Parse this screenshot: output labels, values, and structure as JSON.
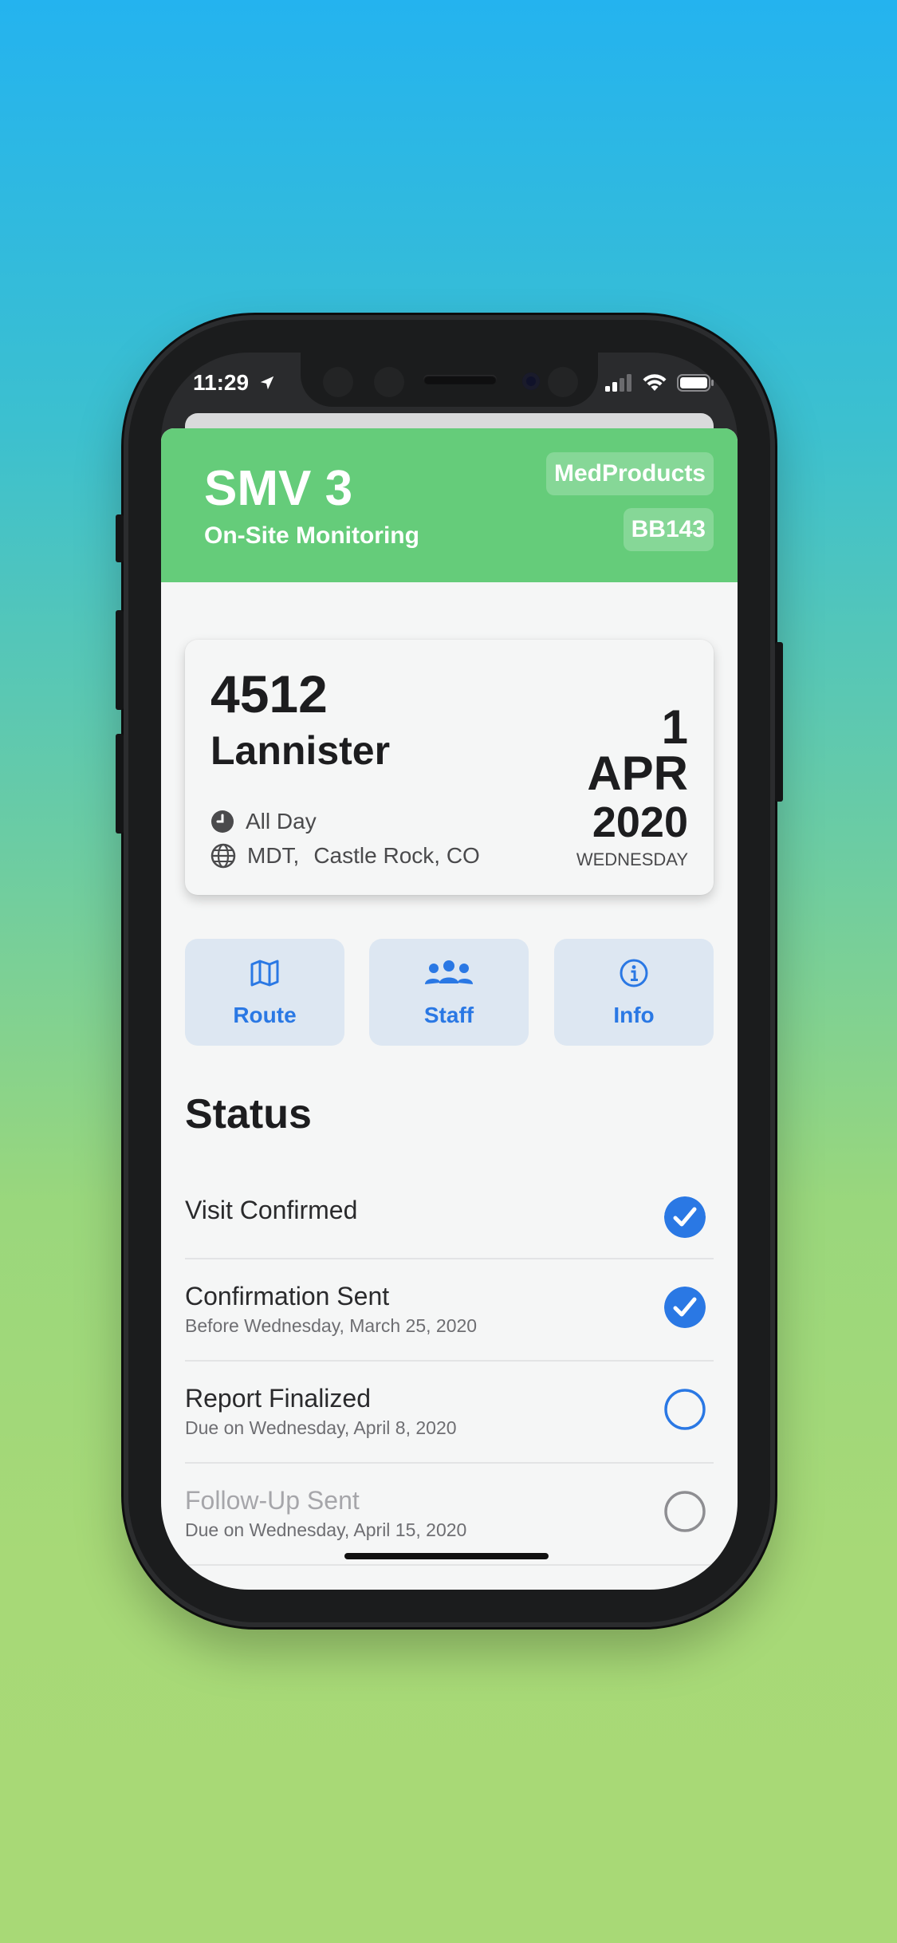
{
  "status_bar": {
    "time": "11:29"
  },
  "header": {
    "title": "SMV 3",
    "subtitle": "On-Site Monitoring",
    "tag_company": "MedProducts",
    "tag_code": "BB143"
  },
  "visit_card": {
    "number": "4512",
    "name": "Lannister",
    "duration": "All Day",
    "timezone": "MDT,",
    "location": "Castle Rock, CO",
    "day": "1",
    "month": "APR",
    "year": "2020",
    "weekday": "WEDNESDAY"
  },
  "actions": [
    {
      "label": "Route",
      "icon": "map-icon"
    },
    {
      "label": "Staff",
      "icon": "people-icon"
    },
    {
      "label": "Info",
      "icon": "info-icon"
    }
  ],
  "status": {
    "heading": "Status",
    "items": [
      {
        "title": "Visit Confirmed",
        "subtitle": "",
        "done": true
      },
      {
        "title": "Confirmation Sent",
        "subtitle": "Before Wednesday, March 25, 2020",
        "done": true
      },
      {
        "title": "Report Finalized",
        "subtitle": "Due on Wednesday, April 8, 2020",
        "done": false
      },
      {
        "title": "Follow-Up Sent",
        "subtitle": "Due on Wednesday, April 15, 2020",
        "done": false,
        "disabled": true
      }
    ]
  },
  "colors": {
    "accent": "#2a78e4",
    "header_green": "#65cc7a",
    "action_bg": "#dde7f2"
  }
}
